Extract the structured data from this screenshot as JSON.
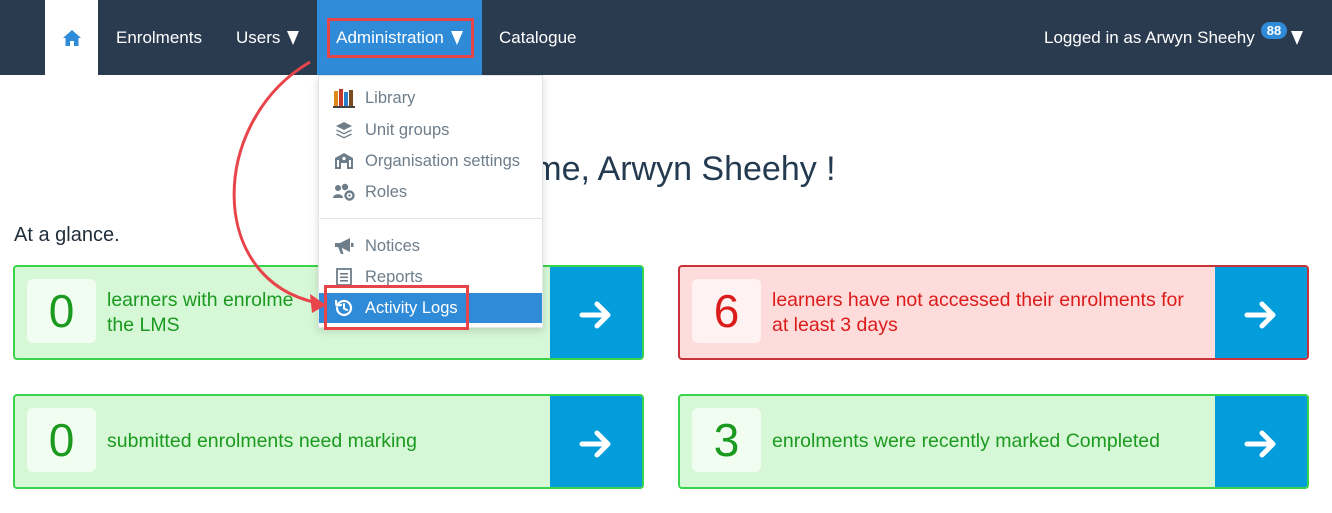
{
  "navbar": {
    "home_icon": "home-icon",
    "enrolments": "Enrolments",
    "users": "Users",
    "administration": "Administration",
    "catalogue": "Catalogue",
    "logged_in": "Logged in as Arwyn Sheehy",
    "badge": "88"
  },
  "dropdown": {
    "items": [
      {
        "label": "Library",
        "icon": "books-icon"
      },
      {
        "label": "Unit groups",
        "icon": "layers-icon"
      },
      {
        "label": "Organisation settings",
        "icon": "building-icon"
      },
      {
        "label": "Roles",
        "icon": "users-cog-icon"
      },
      {
        "label": "Notices",
        "icon": "megaphone-icon"
      },
      {
        "label": "Reports",
        "icon": "report-icon"
      },
      {
        "label": "Activity Logs",
        "icon": "history-icon",
        "active": true
      }
    ]
  },
  "main": {
    "welcome": "ome, Arwyn Sheehy !",
    "at_a_glance": "At a glance."
  },
  "cards": [
    {
      "count": "0",
      "line1": "learners with enrolme",
      "line2": "the LMS",
      "status": "green"
    },
    {
      "count": "6",
      "line1": "learners have not accessed their enrolments for",
      "line2": "at least 3 days",
      "status": "red"
    },
    {
      "count": "0",
      "line1": "submitted enrolments need marking",
      "line2": "",
      "status": "green"
    },
    {
      "count": "3",
      "line1": "enrolments were recently marked Completed",
      "line2": "",
      "status": "green"
    }
  ],
  "colors": {
    "navbar": "#2a3b50",
    "accent": "#2f8bd8",
    "success_bg": "#d6f8d7",
    "success_text": "#1b9a1f",
    "danger_bg": "#ffdcdc",
    "danger_text": "#dc1b1b",
    "arrow_panel": "#049ddc",
    "annotation": "#e8454a"
  }
}
